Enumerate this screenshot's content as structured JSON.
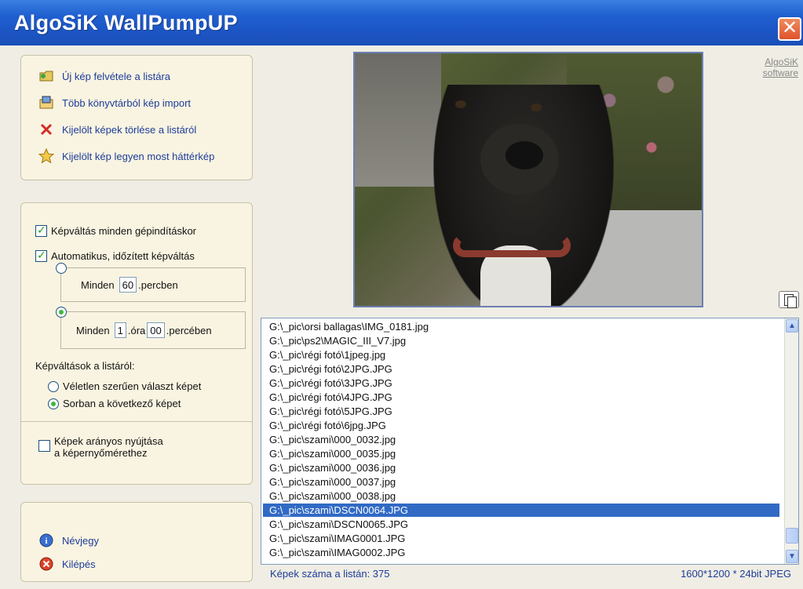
{
  "window": {
    "title": "AlgoSiK WallPumpUP",
    "close_label": "✕"
  },
  "actions": [
    {
      "label": "Új kép felvétele a listára",
      "icon": "add-image-icon"
    },
    {
      "label": "Több könyvtárból kép import",
      "icon": "import-icon"
    },
    {
      "label": "Kijelölt képek törlése a listáról",
      "icon": "delete-icon"
    },
    {
      "label": "Kijelölt kép legyen most háttérkép",
      "icon": "star-icon"
    }
  ],
  "settings": {
    "change_on_boot": {
      "label": "Képváltás minden gépindításkor",
      "checked": true
    },
    "auto_timed": {
      "label": "Automatikus, időzített képváltás",
      "checked": true
    },
    "every_minutes": {
      "prefix": "Minden",
      "value": "60",
      "suffix": ".percben",
      "selected": false
    },
    "every_hour": {
      "prefix": "Minden",
      "hour": "1",
      "hour_suffix": ".óra",
      "minute": "00",
      "minute_suffix": ".percében",
      "selected": true
    },
    "order_heading": "Képváltások a listáról:",
    "random_label": "Véletlen szerűen választ képet",
    "sequential_label": "Sorban a következő képet",
    "stretch_label_1": "Képek arányos nyújtása",
    "stretch_label_2": "a képernyőmérethez",
    "stretch_checked": false
  },
  "footer": {
    "about": "Névjegy",
    "exit": "Kilépés"
  },
  "brand_link": {
    "line1": "AlgoSiK",
    "line2": "software"
  },
  "files": [
    "G:\\_pic\\orsi ballagas\\IMG_0181.jpg",
    "G:\\_pic\\ps2\\MAGIC_III_V7.jpg",
    "G:\\_pic\\régi fotó\\1jpeg.jpg",
    "G:\\_pic\\régi fotó\\2JPG.JPG",
    "G:\\_pic\\régi fotó\\3JPG.JPG",
    "G:\\_pic\\régi fotó\\4JPG.JPG",
    "G:\\_pic\\régi fotó\\5JPG.JPG",
    "G:\\_pic\\régi fotó\\6jpg.JPG",
    "G:\\_pic\\szami\\000_0032.jpg",
    "G:\\_pic\\szami\\000_0035.jpg",
    "G:\\_pic\\szami\\000_0036.jpg",
    "G:\\_pic\\szami\\000_0037.jpg",
    "G:\\_pic\\szami\\000_0038.jpg",
    "G:\\_pic\\szami\\DSCN0064.JPG",
    "G:\\_pic\\szami\\DSCN0065.JPG",
    "G:\\_pic\\szami\\IMAG0001.JPG",
    "G:\\_pic\\szami\\IMAG0002.JPG"
  ],
  "selected_index": 13,
  "status": {
    "count": "Képek száma a listán: 375",
    "info": "1600*1200 * 24bit JPEG"
  },
  "colors": {
    "title_bar": "#1f5fd0",
    "selection": "#316ac5",
    "link": "#1d3c9a"
  }
}
